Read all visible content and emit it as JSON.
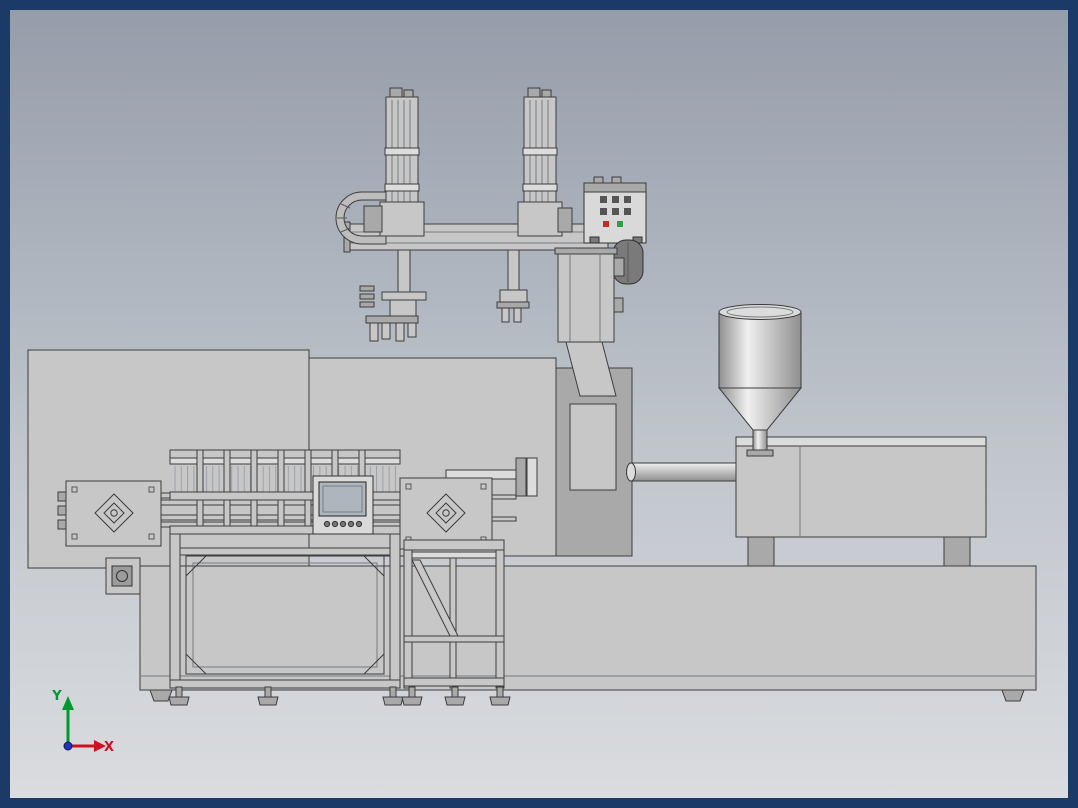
{
  "viewport": {
    "border_color": "#1c3a68",
    "background": {
      "top": "#959daa",
      "middle": "#c0c5cc",
      "bottom": "#dadcdf"
    }
  },
  "axis_triad": {
    "y_label": "Y",
    "x_label": "X",
    "y_color": "#00992e",
    "x_color": "#cc1122",
    "origin_color": "#2233bb"
  },
  "machine": {
    "body_gray": "#c7c7c7",
    "body_light": "#dcdcdc",
    "body_dark": "#a9a9a9",
    "drum_gray": "#7a7a7a",
    "outline": "#3d3d3d",
    "hopper_light": "#f0f0f0",
    "hopper_dark": "#8f8f8f",
    "hmi_screen": "#aeb6bd",
    "indicator_red": "#c12b2b",
    "indicator_green": "#2f9e44"
  }
}
